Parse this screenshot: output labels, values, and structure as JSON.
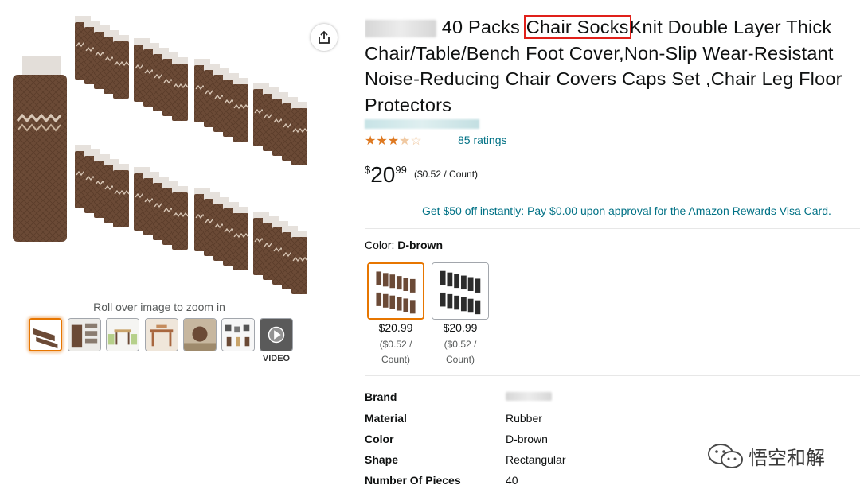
{
  "gallery": {
    "zoom_hint": "Roll over image to zoom in",
    "thumbnails": [
      {
        "icon": "product-main-thumb",
        "selected": true
      },
      {
        "icon": "product-closeup-thumb",
        "selected": false
      },
      {
        "icon": "table-chairs-thumb",
        "selected": false
      },
      {
        "icon": "dining-set-thumb",
        "selected": false
      },
      {
        "icon": "floor-closeup-thumb",
        "selected": false
      },
      {
        "icon": "chairs-room-thumb",
        "selected": false
      },
      {
        "icon": "video-thumb",
        "selected": false
      }
    ],
    "video_label": "VIDEO",
    "share_icon": "share-icon"
  },
  "product": {
    "title_before": "40 Packs",
    "title_highlight": "Chair Socks",
    "title_after": "Knit Double Layer Thick Chair/Table/Bench Foot Cover,Non-Slip Wear-Resistant Noise-Reducing Chair Covers Caps Set ,Chair Leg Floor Protectors",
    "rating_stars": 3.5,
    "ratings_text": "85 ratings",
    "price": {
      "symbol": "$",
      "whole": "20",
      "fraction": "99",
      "unit": "($0.52 / Count)"
    },
    "promo": "Get $50 off instantly: Pay $0.00 upon approval for the Amazon Rewards Visa Card."
  },
  "color": {
    "label": "Color: ",
    "selected": "D-brown",
    "options": [
      {
        "name": "D-brown",
        "price": "$20.99",
        "unit_line1": "($0.52 /",
        "unit_line2": "Count)",
        "swatch": "#6b4a36"
      },
      {
        "name": "Black",
        "price": "$20.99",
        "unit_line1": "($0.52 /",
        "unit_line2": "Count)",
        "swatch": "#2c2c2c"
      }
    ]
  },
  "specs": [
    {
      "key": "Brand",
      "value": ""
    },
    {
      "key": "Material",
      "value": "Rubber"
    },
    {
      "key": "Color",
      "value": "D-brown"
    },
    {
      "key": "Shape",
      "value": "Rectangular"
    },
    {
      "key": "Number Of Pieces",
      "value": "40"
    }
  ],
  "watermark": {
    "text": "悟空和解",
    "icon": "wechat-icon"
  },
  "colors": {
    "link": "#007185",
    "star": "#de7921",
    "highlight_border": "#e0201a",
    "selected_border": "#e77600",
    "product_brown": "#6b4a36"
  }
}
